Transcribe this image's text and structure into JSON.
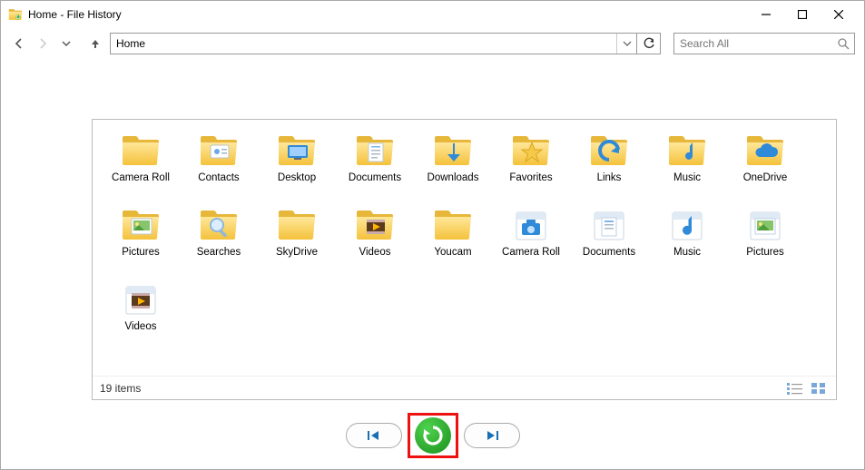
{
  "window": {
    "title": "Home - File History"
  },
  "nav": {
    "address_value": "Home",
    "search_placeholder": "Search All"
  },
  "grid": {
    "items": [
      {
        "label": "Camera Roll",
        "icon": "folder"
      },
      {
        "label": "Contacts",
        "icon": "folder-contacts"
      },
      {
        "label": "Desktop",
        "icon": "folder-desktop"
      },
      {
        "label": "Documents",
        "icon": "folder-docs"
      },
      {
        "label": "Downloads",
        "icon": "folder-down"
      },
      {
        "label": "Favorites",
        "icon": "folder-fav"
      },
      {
        "label": "Links",
        "icon": "folder-links"
      },
      {
        "label": "Music",
        "icon": "folder-music"
      },
      {
        "label": "OneDrive",
        "icon": "folder-cloud"
      },
      {
        "label": "Pictures",
        "icon": "folder-pic"
      },
      {
        "label": "Searches",
        "icon": "folder-search"
      },
      {
        "label": "SkyDrive",
        "icon": "folder"
      },
      {
        "label": "Videos",
        "icon": "folder-video"
      },
      {
        "label": "Youcam",
        "icon": "folder"
      },
      {
        "label": "Camera Roll",
        "icon": "lib-camera"
      },
      {
        "label": "Documents",
        "icon": "lib-docs"
      },
      {
        "label": "Music",
        "icon": "lib-music"
      },
      {
        "label": "Pictures",
        "icon": "lib-pic"
      },
      {
        "label": "Videos",
        "icon": "lib-video"
      }
    ]
  },
  "status": {
    "count_text": "19 items"
  }
}
